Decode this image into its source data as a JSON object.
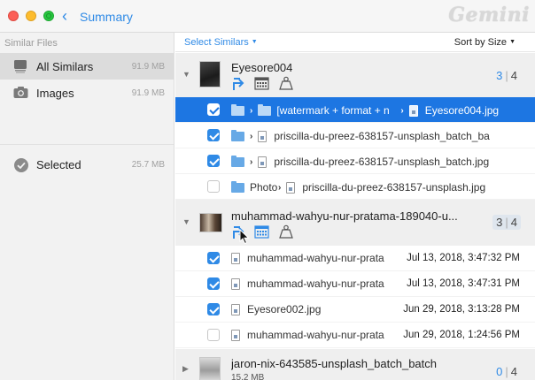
{
  "window": {
    "back_glyph": "‹",
    "title": "Summary",
    "logo": "Gemini"
  },
  "colors": {
    "accent": "#2f8ae6",
    "selection": "#1d76e2",
    "close": "#fc5f57",
    "minimize": "#fdbc2e",
    "maximize": "#28c840"
  },
  "sidebar": {
    "header": "Similar Files",
    "items": [
      {
        "label": "All Similars",
        "size": "91.9 MB",
        "icon": "stack-icon",
        "active": true
      },
      {
        "label": "Images",
        "size": "91.9 MB",
        "icon": "camera-icon",
        "active": false
      },
      {
        "label": "Selected",
        "size": "25.7 MB",
        "icon": "checkmark-circle-icon",
        "active": false
      }
    ]
  },
  "main": {
    "select_similars": "Select Similars",
    "sort_by": "Sort by Size",
    "groups": [
      {
        "name": "Eyesore004",
        "selected_count": "3",
        "total_count": "4",
        "rows": [
          {
            "checked": true,
            "selected_row": true,
            "folder": "[watermark + format + n",
            "file": "Eyesore004.jpg"
          },
          {
            "checked": true,
            "selected_row": false,
            "folder": "",
            "file": "priscilla-du-preez-638157-unsplash_batch_ba"
          },
          {
            "checked": true,
            "selected_row": false,
            "folder": "",
            "file": "priscilla-du-preez-638157-unsplash_batch.jpg"
          },
          {
            "checked": false,
            "selected_row": false,
            "folder": "Photo",
            "file": "priscilla-du-preez-638157-unsplash.jpg"
          }
        ]
      },
      {
        "name": "muhammad-wahyu-nur-pratama-189040-u...",
        "selected_count": "3",
        "total_count": "4",
        "rows": [
          {
            "checked": true,
            "file": "muhammad-wahyu-nur-pratama",
            "date": "Jul 13, 2018, 3:47:32 PM"
          },
          {
            "checked": true,
            "file": "muhammad-wahyu-nur-pratama",
            "date": "Jul 13, 2018, 3:47:31 PM"
          },
          {
            "checked": true,
            "file": "Eyesore002.jpg",
            "date": "Jun 29, 2018, 3:13:28 PM"
          },
          {
            "checked": false,
            "file": "muhammad-wahyu-nur-pratama",
            "date": "Jun 29, 2018, 1:24:56 PM"
          }
        ]
      },
      {
        "name": "jaron-nix-643585-unsplash_batch_batch",
        "size": "15.2 MB",
        "selected_count": "0",
        "total_count": "4"
      }
    ]
  }
}
